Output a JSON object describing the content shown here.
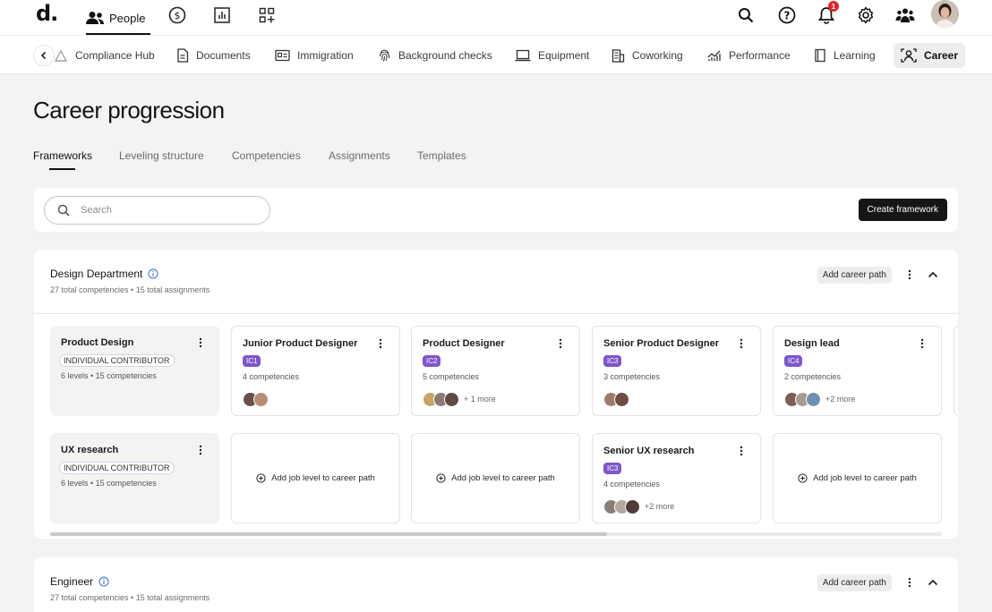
{
  "topbar": {
    "logo": "d.",
    "people_label": "People",
    "notification_count": "1"
  },
  "subnav": {
    "items": [
      "Compliance Hub",
      "Documents",
      "Immigration",
      "Background checks",
      "Equipment",
      "Coworking",
      "Performance",
      "Learning",
      "Career"
    ],
    "active": "Career"
  },
  "page": {
    "title": "Career progression",
    "tabs": [
      "Frameworks",
      "Leveling structure",
      "Competencies",
      "Assignments",
      "Templates"
    ],
    "active_tab": "Frameworks"
  },
  "search": {
    "placeholder": "Search",
    "create_label": "Create framework"
  },
  "departments": [
    {
      "name": "Design Department",
      "meta": "27 total competencies • 15 total assignments",
      "add_label": "Add career path",
      "rows": [
        {
          "path": {
            "title": "Product Design",
            "type": "INDIVIDUAL CONTRIBUTOR",
            "meta": "6 levels • 15 competencies"
          },
          "levels": [
            {
              "title": "Junior Product Designer",
              "ic": "IC1",
              "competencies": "4 competencies",
              "more": ""
            },
            {
              "title": "Product Designer",
              "ic": "IC2",
              "competencies": "5 competencies",
              "more": "+ 1 more"
            },
            {
              "title": "Senior Product Designer",
              "ic": "IC3",
              "competencies": "3 competencies",
              "more": ""
            },
            {
              "title": "Design lead",
              "ic": "IC4",
              "competencies": "2 competencies",
              "more": "+2 more"
            }
          ]
        },
        {
          "path": {
            "title": "UX research",
            "type": "INDIVIDUAL CONTRIBUTOR",
            "meta": "6 levels • 15 competencies"
          },
          "add_level_label": "Add job level to career path",
          "levels": [
            {
              "title": "Senior UX research",
              "ic": "IC3",
              "competencies": "4 competencies",
              "more": "+2 more"
            }
          ]
        }
      ]
    },
    {
      "name": "Engineer",
      "meta": "27 total competencies • 15 total assignments",
      "add_label": "Add career path"
    }
  ]
}
